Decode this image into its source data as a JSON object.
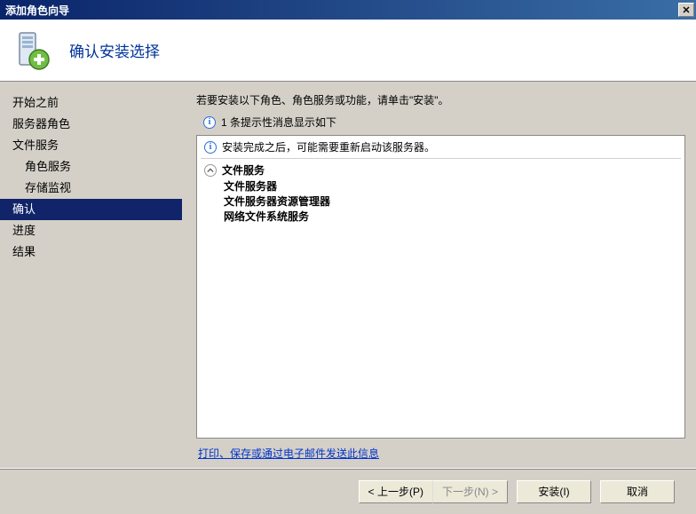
{
  "window": {
    "title": "添加角色向导",
    "close": "✕"
  },
  "header": {
    "title": "确认安装选择"
  },
  "sidebar": {
    "items": [
      {
        "label": "开始之前",
        "sub": false
      },
      {
        "label": "服务器角色",
        "sub": false
      },
      {
        "label": "文件服务",
        "sub": false
      },
      {
        "label": "角色服务",
        "sub": true
      },
      {
        "label": "存储监视",
        "sub": true
      },
      {
        "label": "确认",
        "sub": false,
        "selected": true
      },
      {
        "label": "进度",
        "sub": false
      },
      {
        "label": "结果",
        "sub": false
      }
    ]
  },
  "main": {
    "instruction": "若要安装以下角色、角色服务或功能，请单击\"安装\"。",
    "info_count": "1 条提示性消息显示如下",
    "box_notice": "安装完成之后，可能需要重新启动该服务器。",
    "section_title": "文件服务",
    "items": [
      "文件服务器",
      "文件服务器资源管理器",
      "网络文件系统服务"
    ],
    "link_text": "打印、保存或通过电子邮件发送此信息"
  },
  "footer": {
    "prev": "< 上一步(P)",
    "next": "下一步(N) >",
    "install": "安装(I)",
    "cancel": "取消"
  }
}
